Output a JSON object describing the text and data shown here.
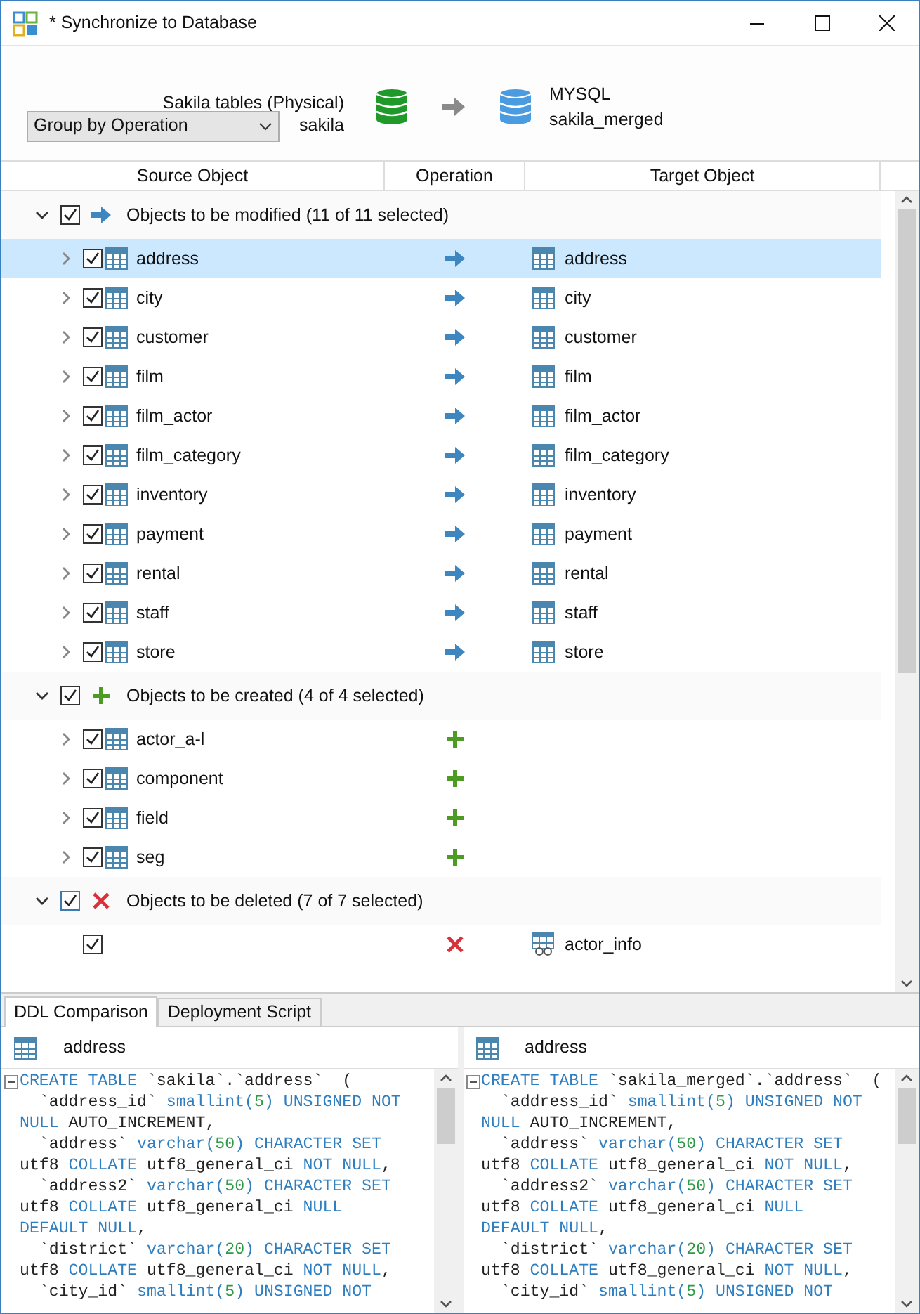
{
  "window": {
    "title": "* Synchronize to Database"
  },
  "header": {
    "group_by": "Group by Operation",
    "source_model": "Sakila tables (Physical)",
    "source_schema": "sakila",
    "target_db": "MYSQL",
    "target_schema": "sakila_merged"
  },
  "columns": [
    "Source Object",
    "Operation",
    "Target Object"
  ],
  "groups": [
    {
      "kind": "modify",
      "label": "Objects to be modified (11 of 11 selected)",
      "expanded": true,
      "checked": true,
      "items": [
        {
          "source": "address",
          "target": "address",
          "kind": "table",
          "checked": true,
          "selected": true,
          "expandable": true
        },
        {
          "source": "city",
          "target": "city",
          "kind": "table",
          "checked": true,
          "selected": false,
          "expandable": true
        },
        {
          "source": "customer",
          "target": "customer",
          "kind": "table",
          "checked": true,
          "selected": false,
          "expandable": true
        },
        {
          "source": "film",
          "target": "film",
          "kind": "table",
          "checked": true,
          "selected": false,
          "expandable": true
        },
        {
          "source": "film_actor",
          "target": "film_actor",
          "kind": "table",
          "checked": true,
          "selected": false,
          "expandable": true
        },
        {
          "source": "film_category",
          "target": "film_category",
          "kind": "table",
          "checked": true,
          "selected": false,
          "expandable": true
        },
        {
          "source": "inventory",
          "target": "inventory",
          "kind": "table",
          "checked": true,
          "selected": false,
          "expandable": true
        },
        {
          "source": "payment",
          "target": "payment",
          "kind": "table",
          "checked": true,
          "selected": false,
          "expandable": true
        },
        {
          "source": "rental",
          "target": "rental",
          "kind": "table",
          "checked": true,
          "selected": false,
          "expandable": true
        },
        {
          "source": "staff",
          "target": "staff",
          "kind": "table",
          "checked": true,
          "selected": false,
          "expandable": true
        },
        {
          "source": "store",
          "target": "store",
          "kind": "table",
          "checked": true,
          "selected": false,
          "expandable": true
        }
      ]
    },
    {
      "kind": "create",
      "label": "Objects to be created (4 of 4 selected)",
      "expanded": true,
      "checked": true,
      "items": [
        {
          "source": "actor_a-l",
          "kind": "table",
          "checked": true,
          "selected": false,
          "expandable": true
        },
        {
          "source": "component",
          "kind": "table",
          "checked": true,
          "selected": false,
          "expandable": true
        },
        {
          "source": "field",
          "kind": "table",
          "checked": true,
          "selected": false,
          "expandable": true
        },
        {
          "source": "seg",
          "kind": "table",
          "checked": true,
          "selected": false,
          "expandable": true
        }
      ]
    },
    {
      "kind": "delete",
      "label": "Objects to be deleted (7 of 7 selected)",
      "expanded": true,
      "checked": true,
      "items": [
        {
          "target": "actor_info",
          "kind": "view",
          "checked": true,
          "selected": false,
          "expandable": false
        }
      ]
    }
  ],
  "bottom_tabs": [
    {
      "label": "DDL Comparison",
      "selected": true
    },
    {
      "label": "Deployment Script",
      "selected": false
    }
  ],
  "panes": [
    {
      "object": "address",
      "lines": [
        [
          {
            "text": "CREATE TABLE",
            "kind": "keyword"
          },
          {
            "text": " `sakila`.`address`  (",
            "kind": "plain"
          }
        ],
        [
          {
            "text": "  `address_id` ",
            "kind": "plain"
          },
          {
            "text": "smallint(",
            "kind": "keyword"
          },
          {
            "text": "5",
            "kind": "number"
          },
          {
            "text": ")",
            "kind": "keyword"
          },
          {
            "text": " UNSIGNED NOT",
            "kind": "keyword"
          }
        ],
        [
          {
            "text": "NULL",
            "kind": "keyword"
          },
          {
            "text": " AUTO_INCREMENT,",
            "kind": "plain"
          }
        ],
        [
          {
            "text": "  `address` ",
            "kind": "plain"
          },
          {
            "text": "varchar(",
            "kind": "keyword"
          },
          {
            "text": "50",
            "kind": "number"
          },
          {
            "text": ")",
            "kind": "keyword"
          },
          {
            "text": " CHARACTER SET",
            "kind": "keyword"
          }
        ],
        [
          {
            "text": "utf8 ",
            "kind": "plain"
          },
          {
            "text": "COLLATE",
            "kind": "keyword"
          },
          {
            "text": " utf8_general_ci ",
            "kind": "plain"
          },
          {
            "text": "NOT NULL",
            "kind": "keyword"
          },
          {
            "text": ",",
            "kind": "plain"
          }
        ],
        [
          {
            "text": "  `address2` ",
            "kind": "plain"
          },
          {
            "text": "varchar(",
            "kind": "keyword"
          },
          {
            "text": "50",
            "kind": "number"
          },
          {
            "text": ")",
            "kind": "keyword"
          },
          {
            "text": " CHARACTER SET",
            "kind": "keyword"
          }
        ],
        [
          {
            "text": "utf8 ",
            "kind": "plain"
          },
          {
            "text": "COLLATE",
            "kind": "keyword"
          },
          {
            "text": " utf8_general_ci ",
            "kind": "plain"
          },
          {
            "text": "NULL",
            "kind": "keyword"
          }
        ],
        [
          {
            "text": "DEFAULT NULL",
            "kind": "keyword"
          },
          {
            "text": ",",
            "kind": "plain"
          }
        ],
        [
          {
            "text": "  `district` ",
            "kind": "plain"
          },
          {
            "text": "varchar(",
            "kind": "keyword"
          },
          {
            "text": "20",
            "kind": "number"
          },
          {
            "text": ")",
            "kind": "keyword"
          },
          {
            "text": " CHARACTER SET",
            "kind": "keyword"
          }
        ],
        [
          {
            "text": "utf8 ",
            "kind": "plain"
          },
          {
            "text": "COLLATE",
            "kind": "keyword"
          },
          {
            "text": " utf8_general_ci ",
            "kind": "plain"
          },
          {
            "text": "NOT NULL",
            "kind": "keyword"
          },
          {
            "text": ",",
            "kind": "plain"
          }
        ],
        [
          {
            "text": "  `city_id` ",
            "kind": "plain"
          },
          {
            "text": "smallint(",
            "kind": "keyword"
          },
          {
            "text": "5",
            "kind": "number"
          },
          {
            "text": ")",
            "kind": "keyword"
          },
          {
            "text": " UNSIGNED NOT",
            "kind": "keyword"
          }
        ]
      ]
    },
    {
      "object": "address",
      "lines": [
        [
          {
            "text": "CREATE TABLE",
            "kind": "keyword"
          },
          {
            "text": " `sakila_merged`.`address`  (",
            "kind": "plain"
          }
        ],
        [
          {
            "text": "  `address_id` ",
            "kind": "plain"
          },
          {
            "text": "smallint(",
            "kind": "keyword"
          },
          {
            "text": "5",
            "kind": "number"
          },
          {
            "text": ")",
            "kind": "keyword"
          },
          {
            "text": " UNSIGNED NOT",
            "kind": "keyword"
          }
        ],
        [
          {
            "text": "NULL",
            "kind": "keyword"
          },
          {
            "text": " AUTO_INCREMENT,",
            "kind": "plain"
          }
        ],
        [
          {
            "text": "  `address` ",
            "kind": "plain"
          },
          {
            "text": "varchar(",
            "kind": "keyword"
          },
          {
            "text": "50",
            "kind": "number"
          },
          {
            "text": ")",
            "kind": "keyword"
          },
          {
            "text": " CHARACTER SET",
            "kind": "keyword"
          }
        ],
        [
          {
            "text": "utf8 ",
            "kind": "plain"
          },
          {
            "text": "COLLATE",
            "kind": "keyword"
          },
          {
            "text": " utf8_general_ci ",
            "kind": "plain"
          },
          {
            "text": "NOT NULL",
            "kind": "keyword"
          },
          {
            "text": ",",
            "kind": "plain"
          }
        ],
        [
          {
            "text": "  `address2` ",
            "kind": "plain"
          },
          {
            "text": "varchar(",
            "kind": "keyword"
          },
          {
            "text": "50",
            "kind": "number"
          },
          {
            "text": ")",
            "kind": "keyword"
          },
          {
            "text": " CHARACTER SET",
            "kind": "keyword"
          }
        ],
        [
          {
            "text": "utf8 ",
            "kind": "plain"
          },
          {
            "text": "COLLATE",
            "kind": "keyword"
          },
          {
            "text": " utf8_general_ci ",
            "kind": "plain"
          },
          {
            "text": "NULL",
            "kind": "keyword"
          }
        ],
        [
          {
            "text": "DEFAULT NULL",
            "kind": "keyword"
          },
          {
            "text": ",",
            "kind": "plain"
          }
        ],
        [
          {
            "text": "  `district` ",
            "kind": "plain"
          },
          {
            "text": "varchar(",
            "kind": "keyword"
          },
          {
            "text": "20",
            "kind": "number"
          },
          {
            "text": ")",
            "kind": "keyword"
          },
          {
            "text": " CHARACTER SET",
            "kind": "keyword"
          }
        ],
        [
          {
            "text": "utf8 ",
            "kind": "plain"
          },
          {
            "text": "COLLATE",
            "kind": "keyword"
          },
          {
            "text": " utf8_general_ci ",
            "kind": "plain"
          },
          {
            "text": "NOT NULL",
            "kind": "keyword"
          },
          {
            "text": ",",
            "kind": "plain"
          }
        ],
        [
          {
            "text": "  `city_id` ",
            "kind": "plain"
          },
          {
            "text": "smallint(",
            "kind": "keyword"
          },
          {
            "text": "5",
            "kind": "number"
          },
          {
            "text": ")",
            "kind": "keyword"
          },
          {
            "text": " UNSIGNED NOT",
            "kind": "keyword"
          }
        ]
      ]
    }
  ]
}
